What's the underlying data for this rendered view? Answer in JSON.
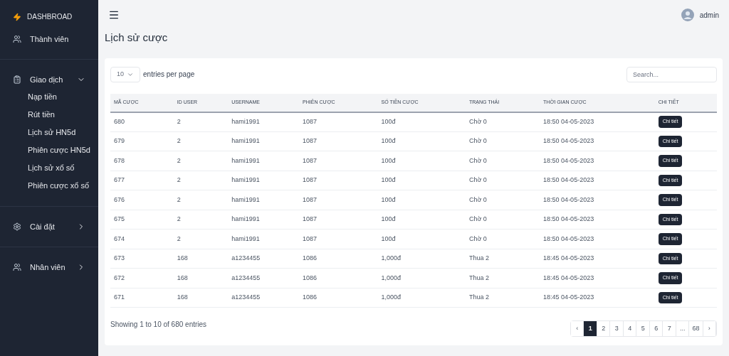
{
  "sidebar": {
    "brand": "DASHBROAD",
    "items": [
      {
        "label": "Thành viên",
        "kind": "link"
      },
      {
        "label": "Giao dịch",
        "kind": "group",
        "expanded": true,
        "children": [
          {
            "label": "Nạp tiền"
          },
          {
            "label": "Rút tiền"
          },
          {
            "label": "Lịch sử HN5d"
          },
          {
            "label": "Phiên cược HN5d"
          },
          {
            "label": "Lịch sử xổ số"
          },
          {
            "label": "Phiên cược xổ số"
          }
        ]
      },
      {
        "label": "Cài đặt",
        "kind": "group",
        "expanded": false
      },
      {
        "label": "Nhân viên",
        "kind": "group",
        "expanded": false
      }
    ]
  },
  "header": {
    "user": "admin"
  },
  "page_title": "Lịch sử cược",
  "table_controls": {
    "page_size": "10",
    "page_size_label": "entries per page",
    "search_placeholder": "Search..."
  },
  "table": {
    "columns": [
      "MÃ CƯỢC",
      "ID USER",
      "USERNAME",
      "PHIÊN CƯỢC",
      "SỐ TIỀN CƯỢC",
      "TRẠNG THÁI",
      "THỜI GIAN CƯỢC",
      "CHI TIẾT"
    ],
    "rows": [
      [
        "680",
        "2",
        "hami1991",
        "1087",
        "100đ",
        "Chờ 0",
        "18:50 04-05-2023",
        "Chi tiết"
      ],
      [
        "679",
        "2",
        "hami1991",
        "1087",
        "100đ",
        "Chờ 0",
        "18:50 04-05-2023",
        "Chi tiết"
      ],
      [
        "678",
        "2",
        "hami1991",
        "1087",
        "100đ",
        "Chờ 0",
        "18:50 04-05-2023",
        "Chi tiết"
      ],
      [
        "677",
        "2",
        "hami1991",
        "1087",
        "100đ",
        "Chờ 0",
        "18:50 04-05-2023",
        "Chi tiết"
      ],
      [
        "676",
        "2",
        "hami1991",
        "1087",
        "100đ",
        "Chờ 0",
        "18:50 04-05-2023",
        "Chi tiết"
      ],
      [
        "675",
        "2",
        "hami1991",
        "1087",
        "100đ",
        "Chờ 0",
        "18:50 04-05-2023",
        "Chi tiết"
      ],
      [
        "674",
        "2",
        "hami1991",
        "1087",
        "100đ",
        "Chờ 0",
        "18:50 04-05-2023",
        "Chi tiết"
      ],
      [
        "673",
        "168",
        "a1234455",
        "1086",
        "1,000đ",
        "Thua 2",
        "18:45 04-05-2023",
        "Chi tiết"
      ],
      [
        "672",
        "168",
        "a1234455",
        "1086",
        "1,000đ",
        "Thua 2",
        "18:45 04-05-2023",
        "Chi tiết"
      ],
      [
        "671",
        "168",
        "a1234455",
        "1086",
        "1,000đ",
        "Thua 2",
        "18:45 04-05-2023",
        "Chi tiết"
      ]
    ]
  },
  "footer": {
    "summary": "Showing 1 to 10 of 680 entries",
    "pages": [
      {
        "label": "‹",
        "selected": false
      },
      {
        "label": "1",
        "selected": true
      },
      {
        "label": "2",
        "selected": false
      },
      {
        "label": "3",
        "selected": false
      },
      {
        "label": "4",
        "selected": false
      },
      {
        "label": "5",
        "selected": false
      },
      {
        "label": "6",
        "selected": false
      },
      {
        "label": "7",
        "selected": false
      },
      {
        "label": "...",
        "selected": false
      },
      {
        "label": "68",
        "selected": false
      },
      {
        "label": "›",
        "selected": false
      }
    ]
  }
}
